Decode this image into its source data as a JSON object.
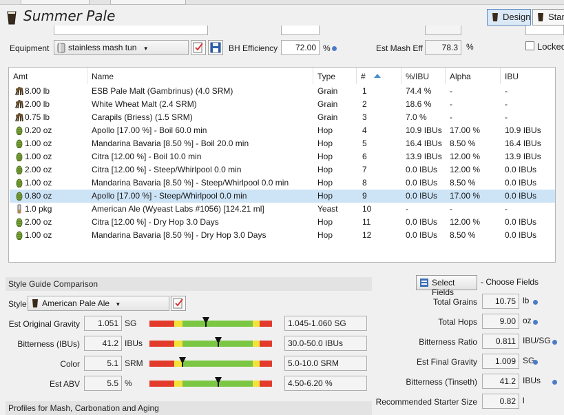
{
  "window": {
    "title": "Summer Pale"
  },
  "modes": {
    "design": "Design",
    "start": "Start"
  },
  "equipment": {
    "label": "Equipment",
    "value": "stainless mash tun",
    "bh_eff_label": "BH Efficiency",
    "bh_eff_value": "72.00",
    "bh_eff_unit": "%",
    "est_mash_eff_label": "Est Mash Eff",
    "est_mash_eff_value": "78.3",
    "est_mash_eff_unit": "%",
    "locked_label": "Locked"
  },
  "grid": {
    "columns": [
      "Amt",
      "Name",
      "Type",
      "#",
      "%/IBU",
      "Alpha",
      "IBU"
    ],
    "rows": [
      {
        "icon": "grain",
        "amt": "8.00 lb",
        "name": "ESB Pale Malt (Gambrinus) (4.0 SRM)",
        "type": "Grain",
        "num": "1",
        "pct": "74.4 %",
        "alpha": "-",
        "ibu": "-"
      },
      {
        "icon": "grain",
        "amt": "2.00 lb",
        "name": "White Wheat Malt (2.4 SRM)",
        "type": "Grain",
        "num": "2",
        "pct": "18.6 %",
        "alpha": "-",
        "ibu": "-"
      },
      {
        "icon": "grain",
        "amt": "0.75 lb",
        "name": "Carapils (Briess) (1.5 SRM)",
        "type": "Grain",
        "num": "3",
        "pct": "7.0 %",
        "alpha": "-",
        "ibu": "-"
      },
      {
        "icon": "hop",
        "amt": "0.20 oz",
        "name": "Apollo [17.00 %] - Boil 60.0 min",
        "type": "Hop",
        "num": "4",
        "pct": "10.9 IBUs",
        "alpha": "17.00 %",
        "ibu": "10.9 IBUs"
      },
      {
        "icon": "hop",
        "amt": "1.00 oz",
        "name": "Mandarina Bavaria [8.50 %] - Boil 20.0 min",
        "type": "Hop",
        "num": "5",
        "pct": "16.4 IBUs",
        "alpha": "8.50 %",
        "ibu": "16.4 IBUs"
      },
      {
        "icon": "hop",
        "amt": "1.00 oz",
        "name": "Citra [12.00 %] - Boil 10.0 min",
        "type": "Hop",
        "num": "6",
        "pct": "13.9 IBUs",
        "alpha": "12.00 %",
        "ibu": "13.9 IBUs"
      },
      {
        "icon": "hop",
        "amt": "2.00 oz",
        "name": "Citra [12.00 %] - Steep/Whirlpool  0.0 min",
        "type": "Hop",
        "num": "7",
        "pct": "0.0 IBUs",
        "alpha": "12.00 %",
        "ibu": "0.0 IBUs"
      },
      {
        "icon": "hop",
        "amt": "1.00 oz",
        "name": "Mandarina Bavaria [8.50 %] - Steep/Whirlpool  0.0 min",
        "type": "Hop",
        "num": "8",
        "pct": "0.0 IBUs",
        "alpha": "8.50 %",
        "ibu": "0.0 IBUs"
      },
      {
        "icon": "hop",
        "amt": "0.80 oz",
        "name": "Apollo [17.00 %] - Steep/Whirlpool  0.0 min",
        "type": "Hop",
        "num": "9",
        "pct": "0.0 IBUs",
        "alpha": "17.00 %",
        "ibu": "0.0 IBUs",
        "selected": true
      },
      {
        "icon": "yeast",
        "amt": "1.0 pkg",
        "name": "American Ale (Wyeast Labs #1056) [124.21 ml]",
        "type": "Yeast",
        "num": "10",
        "pct": "-",
        "alpha": "-",
        "ibu": "-"
      },
      {
        "icon": "hop",
        "amt": "2.00 oz",
        "name": "Citra [12.00 %] - Dry Hop 3.0 Days",
        "type": "Hop",
        "num": "11",
        "pct": "0.0 IBUs",
        "alpha": "12.00 %",
        "ibu": "0.0 IBUs"
      },
      {
        "icon": "hop",
        "amt": "1.00 oz",
        "name": "Mandarina Bavaria [8.50 %] - Dry Hop 3.0 Days",
        "type": "Hop",
        "num": "12",
        "pct": "0.0 IBUs",
        "alpha": "8.50 %",
        "ibu": "0.0 IBUs"
      }
    ]
  },
  "style_guide": {
    "heading": "Style Guide Comparison",
    "style_label": "Style",
    "style_value": "American Pale Ale",
    "rows": [
      {
        "label": "Est Original Gravity",
        "value": "1.051",
        "unit": "SG",
        "range": "1.045-1.060 SG",
        "position": 0.46
      },
      {
        "label": "Bitterness (IBUs)",
        "value": "41.2",
        "unit": "IBUs",
        "range": "30.0-50.0 IBUs",
        "position": 0.56
      },
      {
        "label": "Color",
        "value": "5.1",
        "unit": "SRM",
        "range": "5.0-10.0 SRM",
        "position": 0.27
      },
      {
        "label": "Est ABV",
        "value": "5.5",
        "unit": "%",
        "range": "4.50-6.20 %",
        "position": 0.56
      }
    ],
    "next_heading": "Profiles for Mash, Carbonation and Aging"
  },
  "stats": {
    "select_fields": "Select Fields",
    "choose_fields": "- Choose Fields",
    "rows": [
      {
        "label": "Total Grains",
        "value": "10.75",
        "unit": "lb"
      },
      {
        "label": "Total Hops",
        "value": "9.00",
        "unit": "oz"
      },
      {
        "label": "Bitterness Ratio",
        "value": "0.811",
        "unit": "IBU/SG"
      },
      {
        "label": "Est Final Gravity",
        "value": "1.009",
        "unit": "SG"
      },
      {
        "label": "Bitterness (Tinseth)",
        "value": "41.2",
        "unit": "IBUs"
      },
      {
        "label": "Recommended Starter Size",
        "value": "0.82",
        "unit": "l"
      }
    ]
  },
  "colors": {
    "accent": "#4a7cc7",
    "selection": "#cde4f7"
  }
}
